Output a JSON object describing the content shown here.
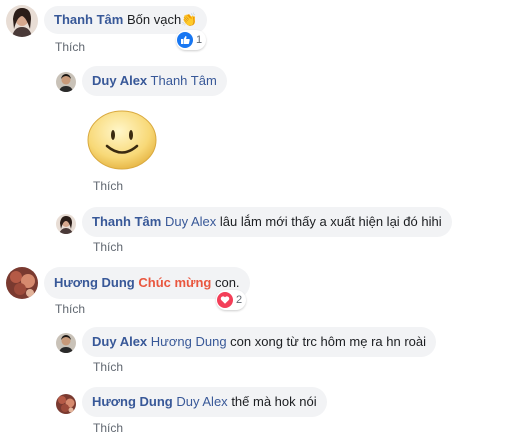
{
  "comments": [
    {
      "author": "Thanh Tâm",
      "text": "Bốn vạch",
      "emoji": "👏",
      "like_label": "Thích",
      "reaction_count": "1",
      "reaction_icon": "thumbs-up-icon"
    },
    {
      "author": "Duy Alex",
      "mention": "Thanh Tâm",
      "text": "",
      "sticker": "smiley-face-sticker",
      "like_label": "Thích"
    },
    {
      "author": "Thanh Tâm",
      "mention": "Duy Alex",
      "text": "lâu lắm mới thấy a xuất hiện lại đó hihi",
      "like_label": "Thích"
    },
    {
      "author": "Hương Dung",
      "highlight": "Chúc mừng",
      "text": "con.",
      "like_label": "Thích",
      "reaction_count": "2",
      "reaction_icon": "heart-icon"
    },
    {
      "author": "Duy Alex",
      "mention": "Hương Dung",
      "text": "con xong từ trc hôm mẹ ra hn roài",
      "like_label": "Thích"
    },
    {
      "author": "Hương Dung",
      "mention": "Duy Alex",
      "text": "thế mà hok nói",
      "like_label": "Thích"
    }
  ],
  "colors": {
    "link": "#385898",
    "highlight": "#e9573f",
    "bubble": "#f2f3f5",
    "meta": "#606770"
  }
}
